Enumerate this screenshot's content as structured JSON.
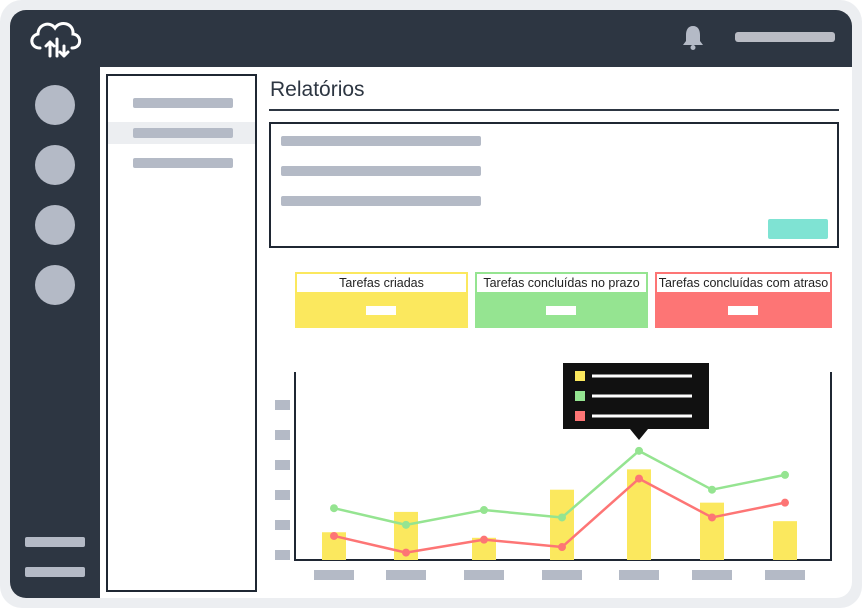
{
  "header": {
    "logo_icon": "cloud-logo-icon",
    "notification_icon": "bell-icon"
  },
  "colors": {
    "dark": "#2d3642",
    "placeholder": "#b4bac6",
    "accent": "#7fe3d3",
    "created": "#fbe85e",
    "on_time": "#95e491",
    "late": "#fd7575"
  },
  "page": {
    "title": "Relatórios"
  },
  "cards": [
    {
      "label": "Tarefas criadas",
      "color": "#fbe85e"
    },
    {
      "label": "Tarefas concluídas no prazo",
      "color": "#95e491"
    },
    {
      "label": "Tarefas concluídas com atraso",
      "color": "#fd7575"
    }
  ],
  "chart_data": {
    "type": "bar",
    "ylim": [
      0,
      100
    ],
    "categories_count": 7,
    "series": [
      {
        "kind": "bar",
        "color": "#fbe85e",
        "values": [
          15,
          26,
          12,
          38,
          49,
          31,
          21
        ]
      },
      {
        "kind": "line",
        "color": "#95e491",
        "values": [
          28,
          19,
          27,
          23,
          59,
          38,
          46
        ]
      },
      {
        "kind": "line",
        "color": "#fd7575",
        "values": [
          13,
          4,
          11,
          7,
          44,
          23,
          31
        ]
      }
    ],
    "tooltip_category": 4
  }
}
